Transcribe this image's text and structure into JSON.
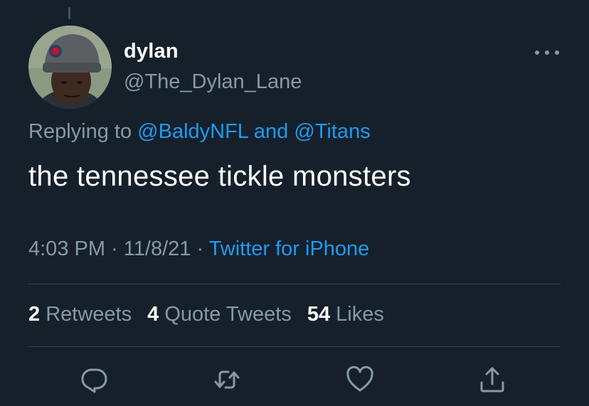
{
  "tweet": {
    "display_name": "dylan",
    "handle": "@The_Dylan_Lane",
    "replying_prefix": "Replying to ",
    "mention_1": "@BaldyNFL",
    "mention_joiner": " and ",
    "mention_2": "@Titans",
    "text": "the tennessee tickle monsters",
    "time": "4:03 PM",
    "date": "11/8/21",
    "separator": " · ",
    "source": "Twitter for iPhone"
  },
  "stats": {
    "retweets_count": "2",
    "retweets_label": "Retweets",
    "quotes_count": "4",
    "quotes_label": "Quote Tweets",
    "likes_count": "54",
    "likes_label": "Likes"
  },
  "icons": {
    "reply": "reply-icon",
    "retweet": "retweet-icon",
    "like": "heart-icon",
    "share": "share-icon",
    "more": "more-icon"
  },
  "colors": {
    "background": "#15202b",
    "link": "#1d9bf0",
    "secondary_text": "#8899a6",
    "divider": "#38444d"
  }
}
